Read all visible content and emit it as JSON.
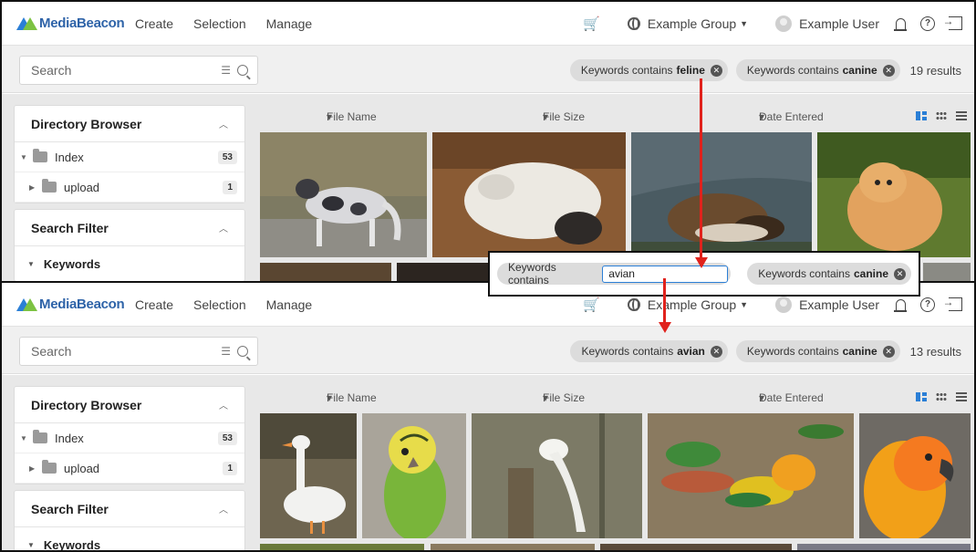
{
  "nav": {
    "logo": "MediaBeacon",
    "create": "Create",
    "selection": "Selection",
    "manage": "Manage",
    "group": "Example Group",
    "user": "Example User",
    "help": "?"
  },
  "search": {
    "placeholder": "Search"
  },
  "columns": {
    "file_name": "File Name",
    "file_size": "File Size",
    "date_entered": "Date Entered"
  },
  "sidebar": {
    "directory_browser": "Directory Browser",
    "tree": [
      {
        "label": "Index",
        "count": "53"
      },
      {
        "label": "upload",
        "count": "1"
      }
    ],
    "search_filter": "Search Filter",
    "keywords": "Keywords"
  },
  "top_state": {
    "filters": [
      {
        "prefix": "Keywords contains",
        "value": "feline"
      },
      {
        "prefix": "Keywords contains",
        "value": "canine"
      }
    ],
    "results": "19 results"
  },
  "callout": {
    "edit_prefix": "Keywords contains",
    "edit_value": "avian",
    "other_prefix": "Keywords contains",
    "other_value": "canine"
  },
  "bottom_state": {
    "filters": [
      {
        "prefix": "Keywords contains",
        "value": "avian"
      },
      {
        "prefix": "Keywords contains",
        "value": "canine"
      }
    ],
    "results": "13 results"
  },
  "thumb_subjects": {
    "top": [
      "merle collie dog",
      "dog sleeping on dirt",
      "dog under blanket",
      "pomeranian dog"
    ],
    "bottom": [
      "white goose",
      "green budgie",
      "white peacock",
      "conures on ground",
      "sun conure"
    ]
  },
  "colors": {
    "accent": "#2b7fd6",
    "annotation_red": "#e0221c",
    "logo_green": "#7cc242"
  }
}
